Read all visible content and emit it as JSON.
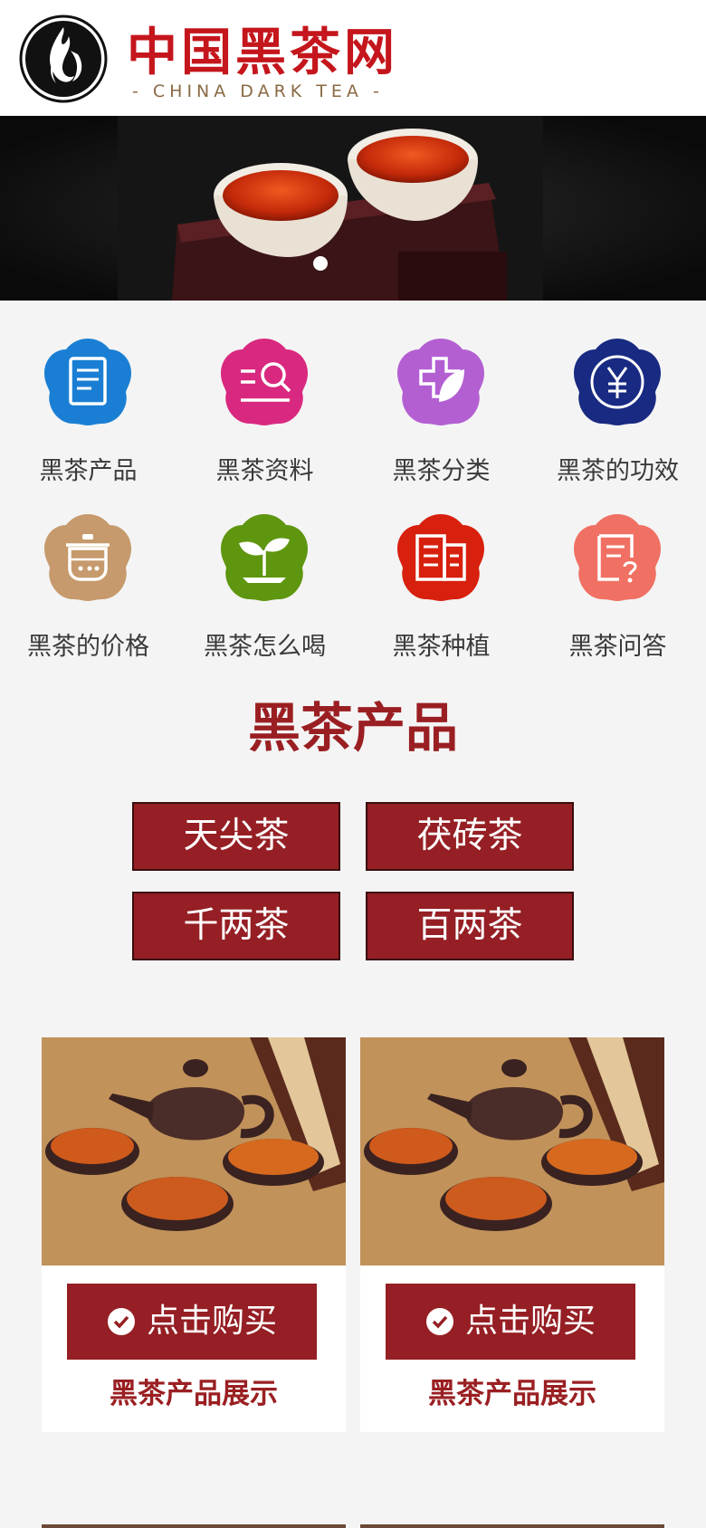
{
  "header": {
    "logo_cn": "中国黑茶网",
    "logo_en": "- CHINA DARK TEA -"
  },
  "colors": {
    "brand_red": "#951f24",
    "title_red": "#9a1f22",
    "background": "#f4f4f4"
  },
  "banner": {
    "slide_count": 1,
    "active_slide": 1
  },
  "categories": [
    {
      "label": "黑茶产品",
      "icon": "document-icon",
      "color": "#1a7fd4"
    },
    {
      "label": "黑茶资料",
      "icon": "search-list-icon",
      "color": "#d9287f"
    },
    {
      "label": "黑茶分类",
      "icon": "leaf-cross-icon",
      "color": "#b35fd2"
    },
    {
      "label": "黑茶的功效",
      "icon": "yen-icon",
      "color": "#182a82"
    },
    {
      "label": "黑茶的价格",
      "icon": "pot-icon",
      "color": "#c69a6c"
    },
    {
      "label": "黑茶怎么喝",
      "icon": "sprout-icon",
      "color": "#5e960f"
    },
    {
      "label": "黑茶种植",
      "icon": "building-icon",
      "color": "#d8200e"
    },
    {
      "label": "黑茶问答",
      "icon": "question-doc-icon",
      "color": "#f07063"
    }
  ],
  "section": {
    "title": "黑茶产品",
    "tags": [
      "天尖茶",
      "茯砖茶",
      "千两茶",
      "百两茶"
    ]
  },
  "products": [
    {
      "button": "点击购买",
      "caption": "黑茶产品展示"
    },
    {
      "button": "点击购买",
      "caption": "黑茶产品展示"
    }
  ]
}
